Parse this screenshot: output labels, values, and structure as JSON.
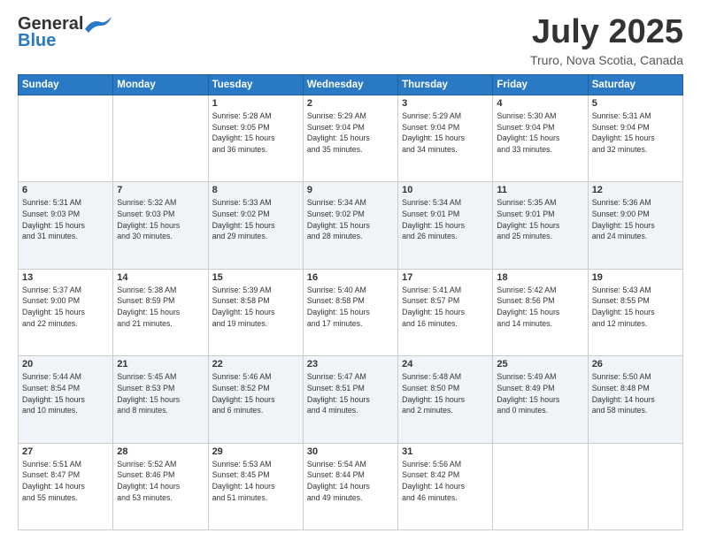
{
  "header": {
    "logo_line1": "General",
    "logo_line2": "Blue",
    "month": "July 2025",
    "location": "Truro, Nova Scotia, Canada"
  },
  "weekdays": [
    "Sunday",
    "Monday",
    "Tuesday",
    "Wednesday",
    "Thursday",
    "Friday",
    "Saturday"
  ],
  "rows": [
    [
      {
        "day": "",
        "info": ""
      },
      {
        "day": "",
        "info": ""
      },
      {
        "day": "1",
        "info": "Sunrise: 5:28 AM\nSunset: 9:05 PM\nDaylight: 15 hours\nand 36 minutes."
      },
      {
        "day": "2",
        "info": "Sunrise: 5:29 AM\nSunset: 9:04 PM\nDaylight: 15 hours\nand 35 minutes."
      },
      {
        "day": "3",
        "info": "Sunrise: 5:29 AM\nSunset: 9:04 PM\nDaylight: 15 hours\nand 34 minutes."
      },
      {
        "day": "4",
        "info": "Sunrise: 5:30 AM\nSunset: 9:04 PM\nDaylight: 15 hours\nand 33 minutes."
      },
      {
        "day": "5",
        "info": "Sunrise: 5:31 AM\nSunset: 9:04 PM\nDaylight: 15 hours\nand 32 minutes."
      }
    ],
    [
      {
        "day": "6",
        "info": "Sunrise: 5:31 AM\nSunset: 9:03 PM\nDaylight: 15 hours\nand 31 minutes."
      },
      {
        "day": "7",
        "info": "Sunrise: 5:32 AM\nSunset: 9:03 PM\nDaylight: 15 hours\nand 30 minutes."
      },
      {
        "day": "8",
        "info": "Sunrise: 5:33 AM\nSunset: 9:02 PM\nDaylight: 15 hours\nand 29 minutes."
      },
      {
        "day": "9",
        "info": "Sunrise: 5:34 AM\nSunset: 9:02 PM\nDaylight: 15 hours\nand 28 minutes."
      },
      {
        "day": "10",
        "info": "Sunrise: 5:34 AM\nSunset: 9:01 PM\nDaylight: 15 hours\nand 26 minutes."
      },
      {
        "day": "11",
        "info": "Sunrise: 5:35 AM\nSunset: 9:01 PM\nDaylight: 15 hours\nand 25 minutes."
      },
      {
        "day": "12",
        "info": "Sunrise: 5:36 AM\nSunset: 9:00 PM\nDaylight: 15 hours\nand 24 minutes."
      }
    ],
    [
      {
        "day": "13",
        "info": "Sunrise: 5:37 AM\nSunset: 9:00 PM\nDaylight: 15 hours\nand 22 minutes."
      },
      {
        "day": "14",
        "info": "Sunrise: 5:38 AM\nSunset: 8:59 PM\nDaylight: 15 hours\nand 21 minutes."
      },
      {
        "day": "15",
        "info": "Sunrise: 5:39 AM\nSunset: 8:58 PM\nDaylight: 15 hours\nand 19 minutes."
      },
      {
        "day": "16",
        "info": "Sunrise: 5:40 AM\nSunset: 8:58 PM\nDaylight: 15 hours\nand 17 minutes."
      },
      {
        "day": "17",
        "info": "Sunrise: 5:41 AM\nSunset: 8:57 PM\nDaylight: 15 hours\nand 16 minutes."
      },
      {
        "day": "18",
        "info": "Sunrise: 5:42 AM\nSunset: 8:56 PM\nDaylight: 15 hours\nand 14 minutes."
      },
      {
        "day": "19",
        "info": "Sunrise: 5:43 AM\nSunset: 8:55 PM\nDaylight: 15 hours\nand 12 minutes."
      }
    ],
    [
      {
        "day": "20",
        "info": "Sunrise: 5:44 AM\nSunset: 8:54 PM\nDaylight: 15 hours\nand 10 minutes."
      },
      {
        "day": "21",
        "info": "Sunrise: 5:45 AM\nSunset: 8:53 PM\nDaylight: 15 hours\nand 8 minutes."
      },
      {
        "day": "22",
        "info": "Sunrise: 5:46 AM\nSunset: 8:52 PM\nDaylight: 15 hours\nand 6 minutes."
      },
      {
        "day": "23",
        "info": "Sunrise: 5:47 AM\nSunset: 8:51 PM\nDaylight: 15 hours\nand 4 minutes."
      },
      {
        "day": "24",
        "info": "Sunrise: 5:48 AM\nSunset: 8:50 PM\nDaylight: 15 hours\nand 2 minutes."
      },
      {
        "day": "25",
        "info": "Sunrise: 5:49 AM\nSunset: 8:49 PM\nDaylight: 15 hours\nand 0 minutes."
      },
      {
        "day": "26",
        "info": "Sunrise: 5:50 AM\nSunset: 8:48 PM\nDaylight: 14 hours\nand 58 minutes."
      }
    ],
    [
      {
        "day": "27",
        "info": "Sunrise: 5:51 AM\nSunset: 8:47 PM\nDaylight: 14 hours\nand 55 minutes."
      },
      {
        "day": "28",
        "info": "Sunrise: 5:52 AM\nSunset: 8:46 PM\nDaylight: 14 hours\nand 53 minutes."
      },
      {
        "day": "29",
        "info": "Sunrise: 5:53 AM\nSunset: 8:45 PM\nDaylight: 14 hours\nand 51 minutes."
      },
      {
        "day": "30",
        "info": "Sunrise: 5:54 AM\nSunset: 8:44 PM\nDaylight: 14 hours\nand 49 minutes."
      },
      {
        "day": "31",
        "info": "Sunrise: 5:56 AM\nSunset: 8:42 PM\nDaylight: 14 hours\nand 46 minutes."
      },
      {
        "day": "",
        "info": ""
      },
      {
        "day": "",
        "info": ""
      }
    ]
  ]
}
